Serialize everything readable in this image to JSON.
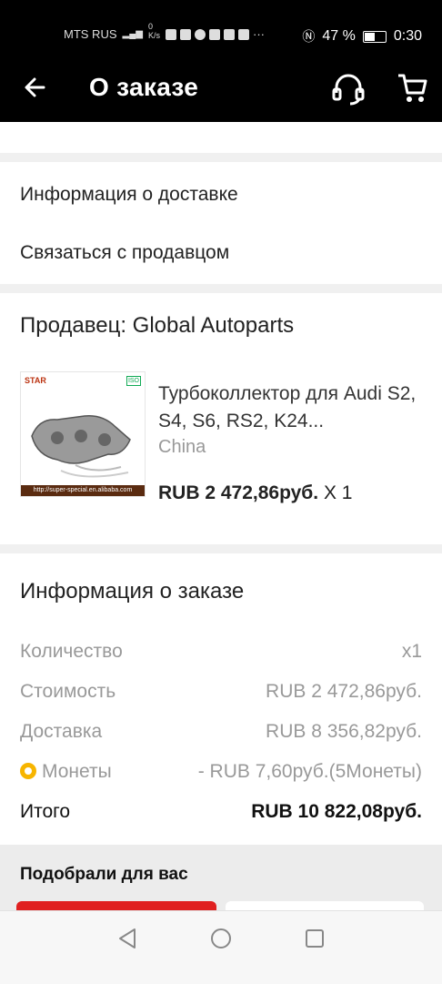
{
  "status_bar": {
    "carrier": "MTS RUS",
    "speed": "0\nK/s",
    "battery": "47 %",
    "time": "0:30"
  },
  "app_bar": {
    "title": "О заказе",
    "back_icon": "arrow-left-icon",
    "support_icon": "headset-icon",
    "cart_icon": "cart-icon"
  },
  "links": {
    "delivery_info": "Информация о доставке",
    "contact_seller": "Связаться с продавцом"
  },
  "seller": {
    "label": "Продавец: Global Autoparts",
    "product": {
      "name": "Турбоколлектор для Audi S2, S4, S6, RS2, K24...",
      "origin": "China",
      "price": "RUB 2 472,86руб.",
      "qty": " X 1",
      "thumb_logo": "STAR",
      "thumb_iso": "ISO",
      "thumb_url": "http://super-special.en.alibaba.com"
    }
  },
  "order_info": {
    "title": "Информация о заказе",
    "rows": [
      {
        "label": "Количество",
        "value": "x1"
      },
      {
        "label": "Стоимость",
        "value": "RUB 2 472,86руб."
      },
      {
        "label": "Доставка",
        "value": "RUB 8 356,82руб."
      },
      {
        "label": "Монеты",
        "value": "- RUB 7,60руб.(5Монеты)"
      }
    ],
    "total": {
      "label": "Итого",
      "value": "RUB 10 822,08руб."
    }
  },
  "recommendations": {
    "title": "Подобрали для вас"
  },
  "nav": {
    "back": "nav-back-icon",
    "home": "nav-home-icon",
    "recents": "nav-recents-icon"
  },
  "colors": {
    "accent_coin": "#f7b500",
    "header_bg": "#000000"
  }
}
